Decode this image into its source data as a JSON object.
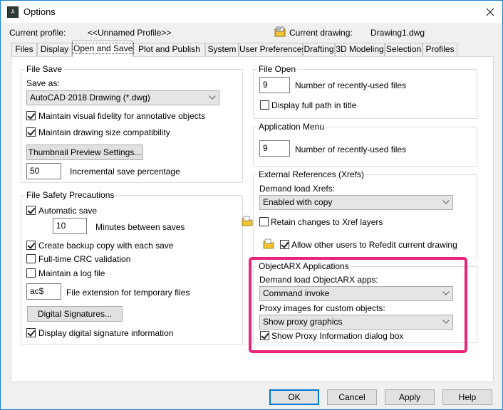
{
  "window": {
    "title": "Options",
    "app_icon_text": "A"
  },
  "profile": {
    "current_profile_label": "Current profile:",
    "current_profile_value": "<<Unnamed Profile>>",
    "current_drawing_label": "Current drawing:",
    "current_drawing_value": "Drawing1.dwg"
  },
  "tabs": [
    {
      "label": "Files"
    },
    {
      "label": "Display"
    },
    {
      "label": "Open and Save",
      "active": true
    },
    {
      "label": "Plot and Publish"
    },
    {
      "label": "System"
    },
    {
      "label": "User Preferences"
    },
    {
      "label": "Drafting"
    },
    {
      "label": "3D Modeling"
    },
    {
      "label": "Selection"
    },
    {
      "label": "Profiles"
    }
  ],
  "file_save": {
    "title": "File Save",
    "save_as_label": "Save as:",
    "save_as_value": "AutoCAD 2018 Drawing (*.dwg)",
    "maintain_fidelity": {
      "label": "Maintain visual fidelity for annotative objects",
      "checked": true
    },
    "maintain_size": {
      "label": "Maintain drawing size compatibility",
      "checked": true
    },
    "thumbnail_button": "Thumbnail Preview Settings...",
    "incremental_value": "50",
    "incremental_label": "Incremental save percentage"
  },
  "file_safety": {
    "title": "File Safety Precautions",
    "automatic_save": {
      "label": "Automatic save",
      "checked": true
    },
    "minutes_value": "10",
    "minutes_label": "Minutes between saves",
    "backup_copy": {
      "label": "Create backup copy with each save",
      "checked": true
    },
    "crc_validation": {
      "label": "Full-time CRC validation",
      "checked": false
    },
    "log_file": {
      "label": "Maintain a log file",
      "checked": false
    },
    "temp_ext_value": "ac$",
    "temp_ext_label": "File extension for temporary files",
    "digital_signatures_button": "Digital Signatures...",
    "display_signature": {
      "label": "Display digital signature information",
      "checked": true
    }
  },
  "file_open": {
    "title": "File Open",
    "recent_value": "9",
    "recent_label": "Number of recently-used files",
    "full_path": {
      "label": "Display full path in title",
      "checked": false
    }
  },
  "app_menu": {
    "title": "Application Menu",
    "recent_value": "9",
    "recent_label": "Number of recently-used files"
  },
  "xrefs": {
    "title": "External References (Xrefs)",
    "demand_label": "Demand load Xrefs:",
    "demand_value": "Enabled with copy",
    "retain_changes": {
      "label": "Retain changes to Xref layers",
      "checked": false
    },
    "allow_refedit": {
      "label": "Allow other users to Refedit current drawing",
      "checked": true
    }
  },
  "objectarx": {
    "title": "ObjectARX Applications",
    "demand_label": "Demand load ObjectARX apps:",
    "demand_value": "Command invoke",
    "proxy_label": "Proxy images for custom objects:",
    "proxy_value": "Show proxy graphics",
    "show_proxy_dialog": {
      "label": "Show Proxy Information dialog box",
      "checked": true
    }
  },
  "buttons": {
    "ok": "OK",
    "cancel": "Cancel",
    "apply": "Apply",
    "help": "Help"
  },
  "colors": {
    "highlight": "#e8257a",
    "accent": "#0078d7"
  },
  "icons": [
    "close-icon",
    "drawing-icon",
    "folder-icon",
    "chevron-down-icon",
    "checkmark-icon"
  ]
}
